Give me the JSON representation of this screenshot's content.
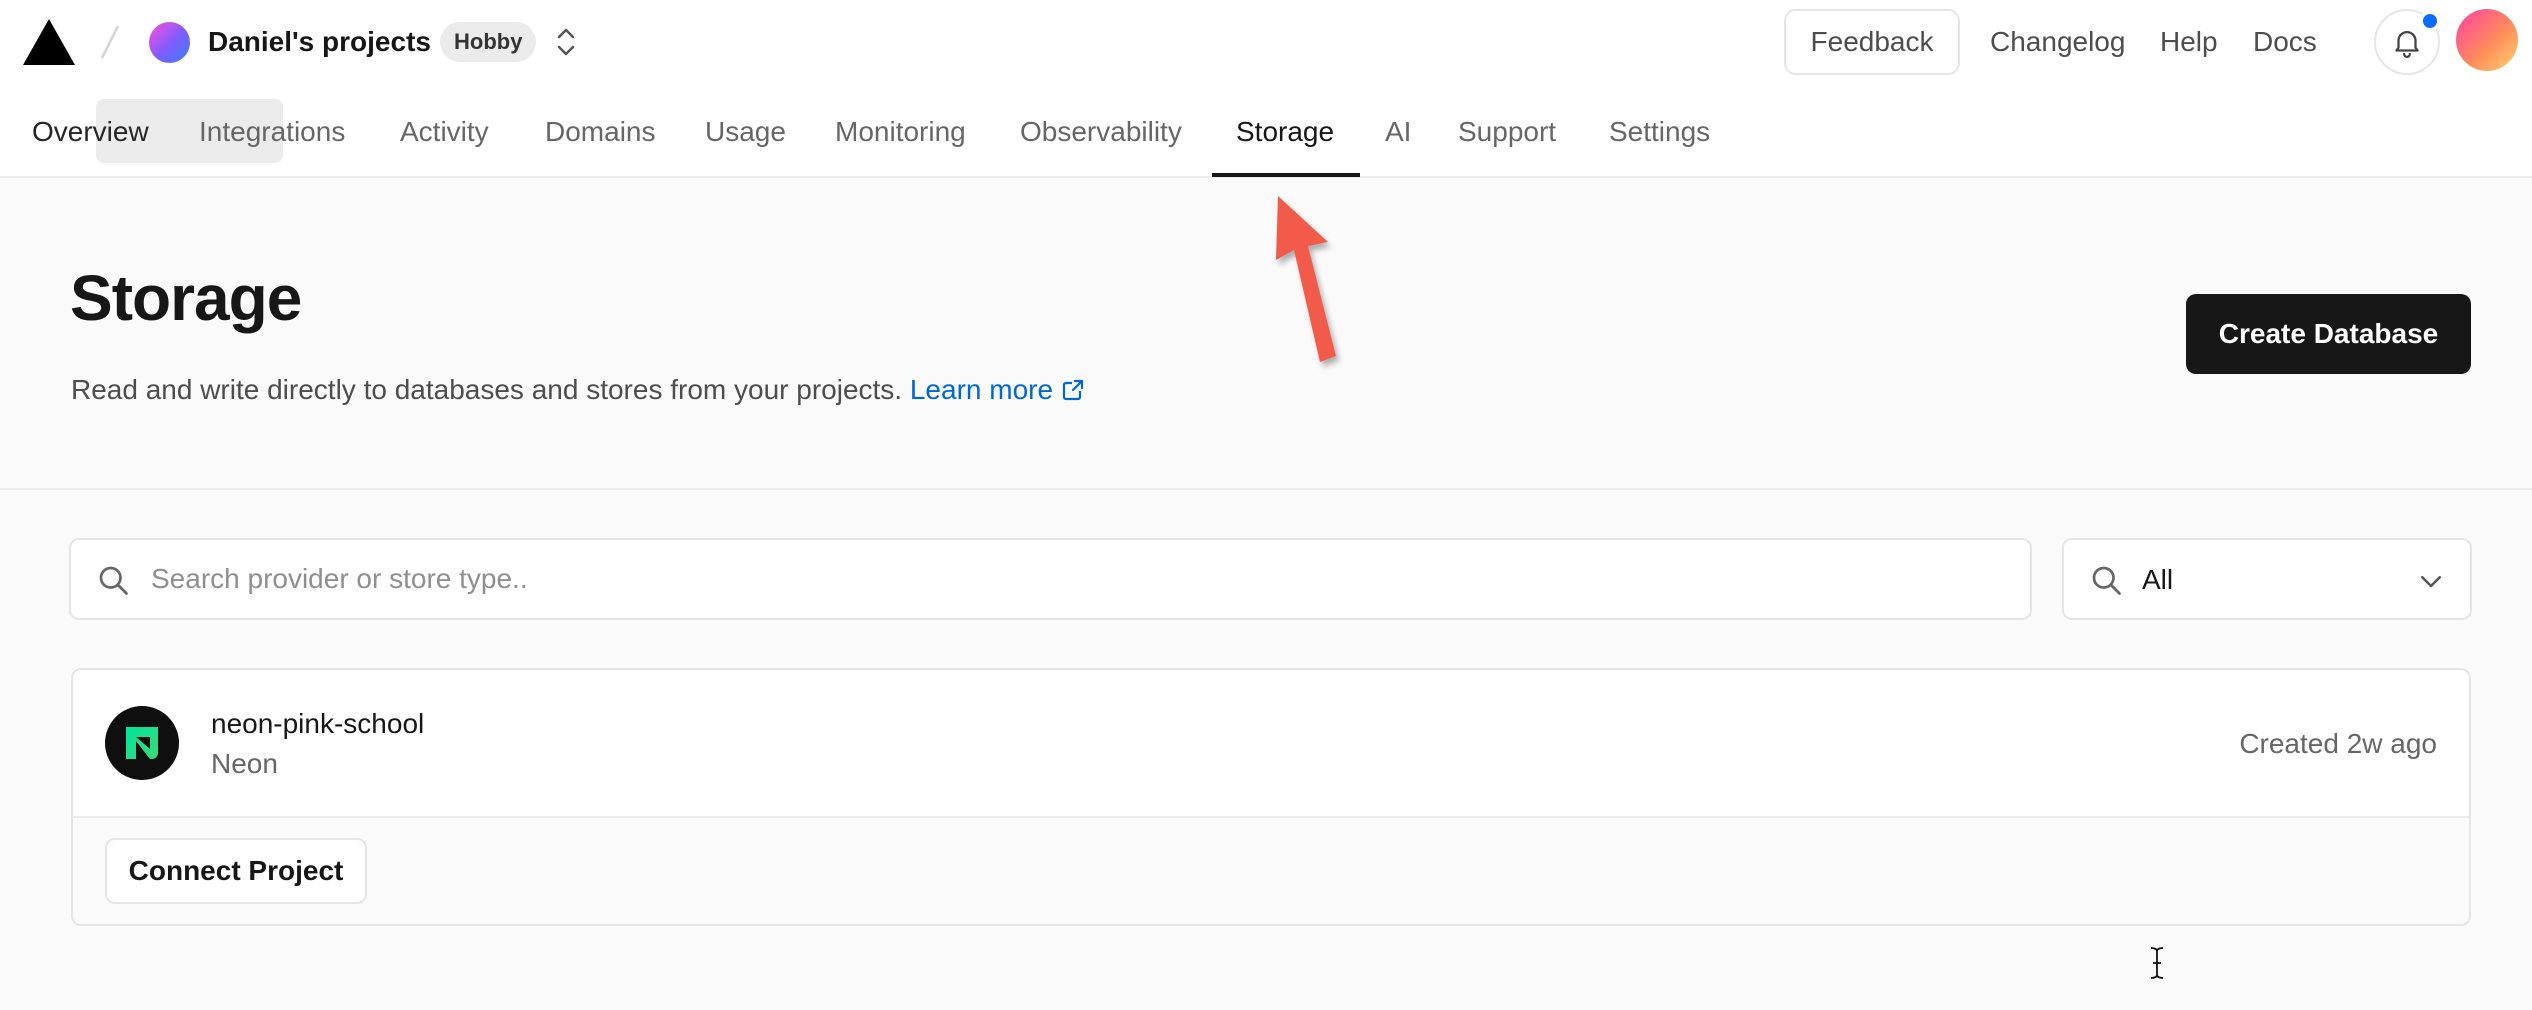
{
  "header": {
    "team_name": "Daniel's projects",
    "plan_badge": "Hobby",
    "feedback_label": "Feedback",
    "links": [
      "Changelog",
      "Help",
      "Docs"
    ]
  },
  "tabs": [
    {
      "label": "Overview"
    },
    {
      "label": "Integrations"
    },
    {
      "label": "Activity"
    },
    {
      "label": "Domains"
    },
    {
      "label": "Usage"
    },
    {
      "label": "Monitoring"
    },
    {
      "label": "Observability"
    },
    {
      "label": "Storage",
      "active": true
    },
    {
      "label": "AI"
    },
    {
      "label": "Support"
    },
    {
      "label": "Settings"
    }
  ],
  "page": {
    "title": "Storage",
    "description": "Read and write directly to databases and stores from your projects.",
    "learn_more_label": "Learn more",
    "create_button_label": "Create Database"
  },
  "search": {
    "placeholder": "Search provider or store type.."
  },
  "filter": {
    "selected": "All"
  },
  "stores": [
    {
      "name": "neon-pink-school",
      "provider": "Neon",
      "created": "Created 2w ago",
      "connect_label": "Connect Project"
    }
  ],
  "icons": {
    "logo": "vercel-triangle-icon",
    "switcher": "chevron-up-down-icon",
    "bell": "bell-icon",
    "search": "search-icon",
    "chevron": "chevron-down-icon",
    "external": "external-link-icon",
    "provider": "neon-logo-icon"
  },
  "colors": {
    "accent_link": "#0068d6",
    "primary_button": "#171717",
    "notification_dot": "#0a6cff",
    "annotation_arrow": "#f25a4a"
  }
}
